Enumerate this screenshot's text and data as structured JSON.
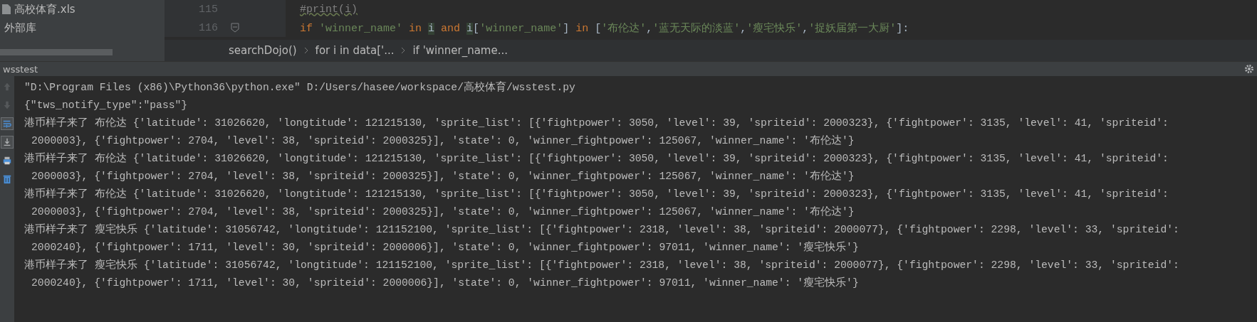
{
  "project_tree": {
    "items": [
      {
        "label": "高校体育.xls",
        "kind": "file"
      },
      {
        "label": "外部库",
        "kind": "library"
      }
    ]
  },
  "editor": {
    "lines": [
      {
        "number": "115",
        "fold": false,
        "tokens": [
          {
            "text": "#print(i)",
            "kind": "comment"
          }
        ]
      },
      {
        "number": "116",
        "fold": true,
        "tokens": [
          {
            "text": "if ",
            "kind": "keyword"
          },
          {
            "text": "'winner_name' ",
            "kind": "string"
          },
          {
            "text": "in ",
            "kind": "keyword"
          },
          {
            "text": "i",
            "kind": "ident"
          },
          {
            "text": " and ",
            "kind": "keyword"
          },
          {
            "text": "i",
            "kind": "ident"
          },
          {
            "text": "[",
            "kind": "plain"
          },
          {
            "text": "'winner_name'",
            "kind": "string"
          },
          {
            "text": "] ",
            "kind": "plain"
          },
          {
            "text": "in",
            "kind": "keyword"
          },
          {
            "text": " [",
            "kind": "plain"
          },
          {
            "text": "'布伦达'",
            "kind": "string"
          },
          {
            "text": ",",
            "kind": "plain"
          },
          {
            "text": "'蓝无天际的淡蓝'",
            "kind": "string"
          },
          {
            "text": ",",
            "kind": "plain"
          },
          {
            "text": "'瘦宅快乐'",
            "kind": "string"
          },
          {
            "text": ",",
            "kind": "plain"
          },
          {
            "text": "'捉妖届第一大厨'",
            "kind": "string"
          },
          {
            "text": "]:",
            "kind": "plain"
          }
        ]
      }
    ],
    "breadcrumbs": [
      "searchDojo()",
      "for i in data['...",
      "if 'winner_name..."
    ]
  },
  "run_panel": {
    "title": "wsstest",
    "toolbar": [
      {
        "kind": "up",
        "disabled": true,
        "on": false
      },
      {
        "kind": "down",
        "disabled": true,
        "on": false
      },
      {
        "kind": "wrap",
        "disabled": false,
        "on": true
      },
      {
        "kind": "scroll_end",
        "disabled": false,
        "on": true
      },
      {
        "kind": "print",
        "disabled": false,
        "on": false
      },
      {
        "kind": "trash",
        "disabled": false,
        "on": false
      }
    ],
    "output": [
      {
        "kind": "command",
        "text": "\"D:\\Program Files (x86)\\Python36\\python.exe\" D:/Users/hasee/workspace/高校体育/wsstest.py"
      },
      {
        "kind": "line",
        "text": "{\"tws_notify_type\":\"pass\"}"
      },
      {
        "kind": "line",
        "text": "港币样子来了 布伦达 {'latitude': 31026620, 'longtitude': 121215130, 'sprite_list': [{'fightpower': 3050, 'level': 39, 'spriteid': 2000323}, {'fightpower': 3135, 'level': 41, 'spriteid':"
      },
      {
        "kind": "wrap",
        "text": "2000003}, {'fightpower': 2704, 'level': 38, 'spriteid': 2000325}], 'state': 0, 'winner_fightpower': 125067, 'winner_name': '布伦达'}"
      },
      {
        "kind": "line",
        "text": "港币样子来了 布伦达 {'latitude': 31026620, 'longtitude': 121215130, 'sprite_list': [{'fightpower': 3050, 'level': 39, 'spriteid': 2000323}, {'fightpower': 3135, 'level': 41, 'spriteid':"
      },
      {
        "kind": "wrap",
        "text": "2000003}, {'fightpower': 2704, 'level': 38, 'spriteid': 2000325}], 'state': 0, 'winner_fightpower': 125067, 'winner_name': '布伦达'}"
      },
      {
        "kind": "line",
        "text": "港币样子来了 布伦达 {'latitude': 31026620, 'longtitude': 121215130, 'sprite_list': [{'fightpower': 3050, 'level': 39, 'spriteid': 2000323}, {'fightpower': 3135, 'level': 41, 'spriteid':"
      },
      {
        "kind": "wrap",
        "text": "2000003}, {'fightpower': 2704, 'level': 38, 'spriteid': 2000325}], 'state': 0, 'winner_fightpower': 125067, 'winner_name': '布伦达'}"
      },
      {
        "kind": "line",
        "text": "港币样子来了 瘦宅快乐 {'latitude': 31056742, 'longtitude': 121152100, 'sprite_list': [{'fightpower': 2318, 'level': 38, 'spriteid': 2000077}, {'fightpower': 2298, 'level': 33, 'spriteid':"
      },
      {
        "kind": "wrap",
        "text": "2000240}, {'fightpower': 1711, 'level': 30, 'spriteid': 2000006}], 'state': 0, 'winner_fightpower': 97011, 'winner_name': '瘦宅快乐'}"
      },
      {
        "kind": "line",
        "text": "港币样子来了 瘦宅快乐 {'latitude': 31056742, 'longtitude': 121152100, 'sprite_list': [{'fightpower': 2318, 'level': 38, 'spriteid': 2000077}, {'fightpower': 2298, 'level': 33, 'spriteid':"
      },
      {
        "kind": "wrap",
        "text": "2000240}, {'fightpower': 1711, 'level': 30, 'spriteid': 2000006}], 'state': 0, 'winner_fightpower': 97011, 'winner_name': '瘦宅快乐'}"
      }
    ]
  }
}
